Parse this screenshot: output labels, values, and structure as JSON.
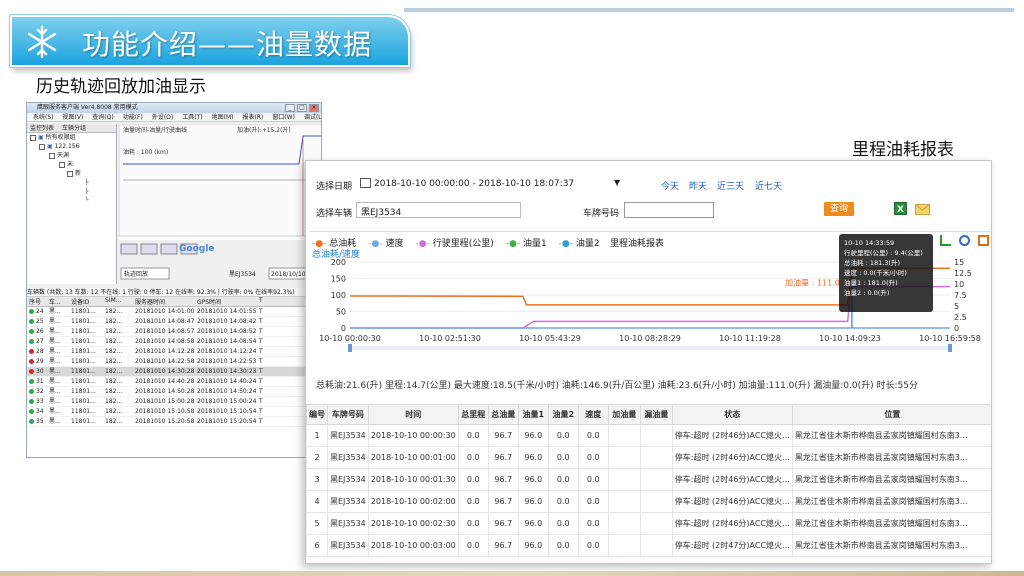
{
  "slide": {
    "title": "功能介绍——油量数据",
    "subtitle": "历史轨迹回放加油显示",
    "right_caption": "里程油耗报表",
    "banner_color": "#1aa3de"
  },
  "app_window": {
    "title": "鹰眼服务客户端 Ver4.8008  常用模式",
    "menu": [
      "系统(S)",
      "视图(V)",
      "查询(Q)",
      "功能(F)",
      "外设(O)",
      "工具(T)",
      "地图(M)",
      "报表(R)",
      "窗口(W)",
      "调试(U)",
      "语言(L)",
      "帮助(H)"
    ],
    "left_tabs": [
      "监控列表",
      "车辆分组"
    ],
    "tree": [
      "所有权限组",
      "122.156",
      "天渊",
      "未",
      "新"
    ],
    "chart_panel_title": "油量时间-油量/行驶曲线",
    "chart_label": "油耗 : 100 (km)",
    "add_label": "加油(升):+15.2(升)",
    "bottom_controls": {
      "plate": "黑EJ3534",
      "play": "轨迹回放",
      "date_from": "2018/10/10"
    },
    "grid_status": "车辆数  (共数: 13 车数: 12 不在线: 1 行驶: 0 停车: 12 在线率: 92.3% | 行驶率: 0% 在线率92.3%)",
    "grid_headers": [
      "序号",
      "车...",
      "设备ID",
      "SIM...",
      "服务器时间",
      "GPS时间",
      "T"
    ],
    "grid_rows": [
      {
        "no": "24",
        "v": "黑...",
        "dev": "11801...",
        "sim": "182...",
        "srv": "20181010 14:01:00",
        "gps": "20181010 14:01:55",
        "t": "T",
        "status": "green"
      },
      {
        "no": "25",
        "v": "黑...",
        "dev": "11801...",
        "sim": "182...",
        "srv": "20181010 14:08:47",
        "gps": "20181010 14:08:42",
        "t": "T",
        "status": "green"
      },
      {
        "no": "26",
        "v": "黑...",
        "dev": "11801...",
        "sim": "182...",
        "srv": "20181010 14:08:57",
        "gps": "20181010 14:08:52",
        "t": "T",
        "status": "green"
      },
      {
        "no": "27",
        "v": "黑...",
        "dev": "11801...",
        "sim": "182...",
        "srv": "20181010 14:08:58",
        "gps": "20181010 14:08:54",
        "t": "T",
        "status": "green"
      },
      {
        "no": "28",
        "v": "黑...",
        "dev": "11801...",
        "sim": "182...",
        "srv": "20181010 14:12:28",
        "gps": "20181010 14:12:24",
        "t": "T",
        "status": "red"
      },
      {
        "no": "29",
        "v": "黑...",
        "dev": "11801...",
        "sim": "182...",
        "srv": "20181010 14:22:58",
        "gps": "20181010 14:22:53",
        "t": "T",
        "status": "red"
      },
      {
        "no": "30",
        "v": "黑...",
        "dev": "11801...",
        "sim": "182...",
        "srv": "20181010 14:30:28",
        "gps": "20181010 14:30:23",
        "t": "T",
        "status": "red",
        "selected": true
      },
      {
        "no": "31",
        "v": "黑...",
        "dev": "11801...",
        "sim": "182...",
        "srv": "20181010 14:40:28",
        "gps": "20181010 14:40:24",
        "t": "T",
        "status": "green"
      },
      {
        "no": "32",
        "v": "黑...",
        "dev": "11801...",
        "sim": "182...",
        "srv": "20181010 14:50:28",
        "gps": "20181010 14:50:24",
        "t": "T",
        "status": "green"
      },
      {
        "no": "33",
        "v": "黑...",
        "dev": "11801...",
        "sim": "182...",
        "srv": "20181010 15:00:28",
        "gps": "20181010 15:00:24",
        "t": "T",
        "status": "green"
      },
      {
        "no": "34",
        "v": "黑...",
        "dev": "11801...",
        "sim": "182...",
        "srv": "20181010 15:10:58",
        "gps": "20181010 15:10:54",
        "t": "T",
        "status": "green"
      },
      {
        "no": "35",
        "v": "黑...",
        "dev": "11801...",
        "sim": "182...",
        "srv": "20181010 15:20:58",
        "gps": "20181010 15:20:54",
        "t": "T",
        "status": "green"
      }
    ]
  },
  "report": {
    "query": {
      "date_label": "选择日期",
      "date_value": "2018-10-10 00:00:00 - 2018-10-10 18:07:37",
      "vehicle_label": "选择车辆",
      "vehicle_value": "黑EJ3534",
      "plate_label": "车牌号码",
      "plate_value": "",
      "quick": [
        "今天",
        "昨天",
        "近三天",
        "近七天"
      ],
      "query_button": "查询",
      "button_color": "#f08c1e"
    },
    "legend": [
      {
        "label": "总油耗",
        "color": "#f07020"
      },
      {
        "label": "速度",
        "color": "#70a8e0"
      },
      {
        "label": "行驶里程(公里)",
        "color": "#d070e0"
      },
      {
        "label": "油量1",
        "color": "#40b040"
      },
      {
        "label": "油量2",
        "color": "#30a0d0"
      }
    ],
    "chart_title": "里程油耗报表",
    "sublegend": "总油耗/速度",
    "tooltip": {
      "time": "10-10 14:33:59",
      "lines": [
        "行驶里程(公里) : 9.4(公里)",
        "总油耗 : 181.3(升)",
        "速度 : 0.0(千米/小时)",
        "油量1 : 181.0(升)",
        "油量2 : 0.0(升)"
      ]
    },
    "add_fuel_label": "加油量 : 111.0",
    "summary": "总耗油:21.6(升) 里程:14.7(公里) 最大速度:18.5(千米/小时) 油耗:146.9(升/百公里) 油耗:23.6(升/小时) 加油量:111.0(升) 漏油量:0.0(升) 时长:55分",
    "table_headers": [
      "编号",
      "车牌号码",
      "时间",
      "总里程",
      "总油量",
      "油量1",
      "油量2",
      "速度",
      "加油量",
      "漏油量",
      "状态",
      "位置"
    ],
    "table_rows": [
      [
        "1",
        "黑EJ3534",
        "2018-10-10 00:00:30",
        "0.0",
        "96.7",
        "96.0",
        "0.0",
        "0.0",
        "",
        "",
        "停车:超时 (2时46分)ACC熄火...",
        "黑龙江省佳木斯市桦南县孟家岗镇耀国村东南3..."
      ],
      [
        "2",
        "黑EJ3534",
        "2018-10-10 00:01:00",
        "0.0",
        "96.7",
        "96.0",
        "0.0",
        "0.0",
        "",
        "",
        "停车:超时 (2时46分)ACC熄火...",
        "黑龙江省佳木斯市桦南县孟家岗镇耀国村东南3..."
      ],
      [
        "3",
        "黑EJ3534",
        "2018-10-10 00:01:30",
        "0.0",
        "96.7",
        "96.0",
        "0.0",
        "0.0",
        "",
        "",
        "停车:超时 (2时46分)ACC熄火...",
        "黑龙江省佳木斯市桦南县孟家岗镇耀国村东南3..."
      ],
      [
        "4",
        "黑EJ3534",
        "2018-10-10 00:02:00",
        "0.0",
        "96.7",
        "96.0",
        "0.0",
        "0.0",
        "",
        "",
        "停车:超时 (2时46分)ACC熄火...",
        "黑龙江省佳木斯市桦南县孟家岗镇耀国村东南3..."
      ],
      [
        "5",
        "黑EJ3534",
        "2018-10-10 00:02:30",
        "0.0",
        "96.7",
        "96.0",
        "0.0",
        "0.0",
        "",
        "",
        "停车:超时 (2时46分)ACC熄火...",
        "黑龙江省佳木斯市桦南县孟家岗镇耀国村东南3..."
      ],
      [
        "6",
        "黑EJ3534",
        "2018-10-10 00:03:00",
        "0.0",
        "96.7",
        "96.0",
        "0.0",
        "0.0",
        "",
        "",
        "停车:超时 (2时47分)ACC熄火...",
        "黑龙江省佳木斯市桦南县孟家岗镇耀国村东南3..."
      ]
    ]
  },
  "chart_data": {
    "type": "line",
    "title": "里程油耗报表",
    "x_ticks": [
      "10-10 00:00:30",
      "10-10 02:51:30",
      "10-10 05:43:29",
      "10-10 08:28:29",
      "10-10 11:19:28",
      "10-10 14:09:23",
      "10-10 16:59:58"
    ],
    "y_left_ticks": [
      0,
      50,
      100,
      150,
      200
    ],
    "y_right_ticks": [
      0,
      2.5,
      5,
      7.5,
      10,
      12.5,
      15
    ],
    "ylim_left": [
      0,
      200
    ],
    "ylim_right": [
      0,
      15
    ],
    "series": [
      {
        "name": "总油耗",
        "color": "#f07020",
        "x": [
          0,
          4.9,
          5.0,
          14.1,
          14.2,
          17.0
        ],
        "values": [
          97,
          96,
          70,
          70,
          181,
          181
        ]
      },
      {
        "name": "行驶里程(公里)",
        "color": "#d070e0",
        "x": [
          0,
          4.9,
          5.2,
          14.1,
          14.2,
          17.0
        ],
        "values": [
          0,
          0,
          1.5,
          1.5,
          9.4,
          9.4
        ],
        "axis": "right"
      },
      {
        "name": "速度",
        "color": "#70a8e0",
        "x": [
          0,
          17.0
        ],
        "values": [
          0,
          0
        ]
      }
    ]
  }
}
